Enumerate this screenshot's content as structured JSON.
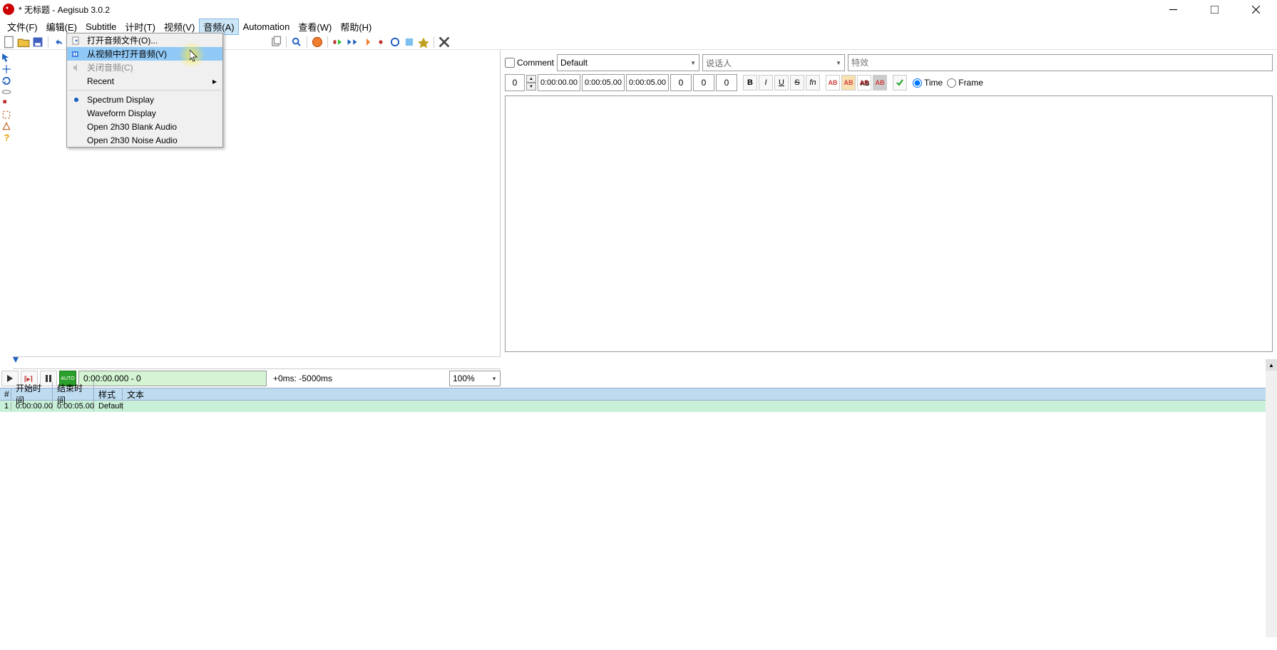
{
  "titlebar": {
    "title": "* 无标题 - Aegisub 3.0.2"
  },
  "menubar": {
    "file": "文件(F)",
    "edit": "编辑(E)",
    "subtitle": "Subtitle",
    "timing": "计时(T)",
    "video": "视频(V)",
    "audio": "音频(A)",
    "automation": "Automation",
    "view": "查看(W)",
    "help": "帮助(H)"
  },
  "audio_menu": {
    "open_file": "打开音频文件(O)...",
    "open_from_video": "从视频中打开音频(V)",
    "close_audio": "关闭音频(C)",
    "recent": "Recent",
    "spectrum": "Spectrum Display",
    "waveform": "Waveform Display",
    "blank": "Open 2h30 Blank Audio",
    "noise": "Open 2h30 Noise Audio"
  },
  "edit_panel": {
    "comment": "Comment",
    "style": "Default",
    "actor_placeholder": "说话人",
    "effect_placeholder": "特效",
    "layer": "0",
    "start_time": "0:00:00.00",
    "end_time": "0:00:05.00",
    "duration": "0:00:05.00",
    "margin_l": "0",
    "margin_r": "0",
    "margin_v": "0",
    "bold": "B",
    "italic": "I",
    "underline": "U",
    "strike": "S",
    "font": "fn",
    "c1": "AB",
    "c2": "AB",
    "c3": "AB",
    "c4": "AB",
    "time_mode": "Time",
    "frame_mode": "Frame"
  },
  "playback": {
    "position": "0:00:00.000 - 0",
    "offset": "+0ms: -5000ms",
    "zoom": "100%"
  },
  "grid": {
    "headers": {
      "num": "#",
      "start": "开始时间",
      "end": "结束时间",
      "style": "样式",
      "text": "文本"
    },
    "rows": [
      {
        "num": "1",
        "start": "0:00:00.00",
        "end": "0:00:05.00",
        "style": "Default",
        "text": ""
      }
    ]
  }
}
